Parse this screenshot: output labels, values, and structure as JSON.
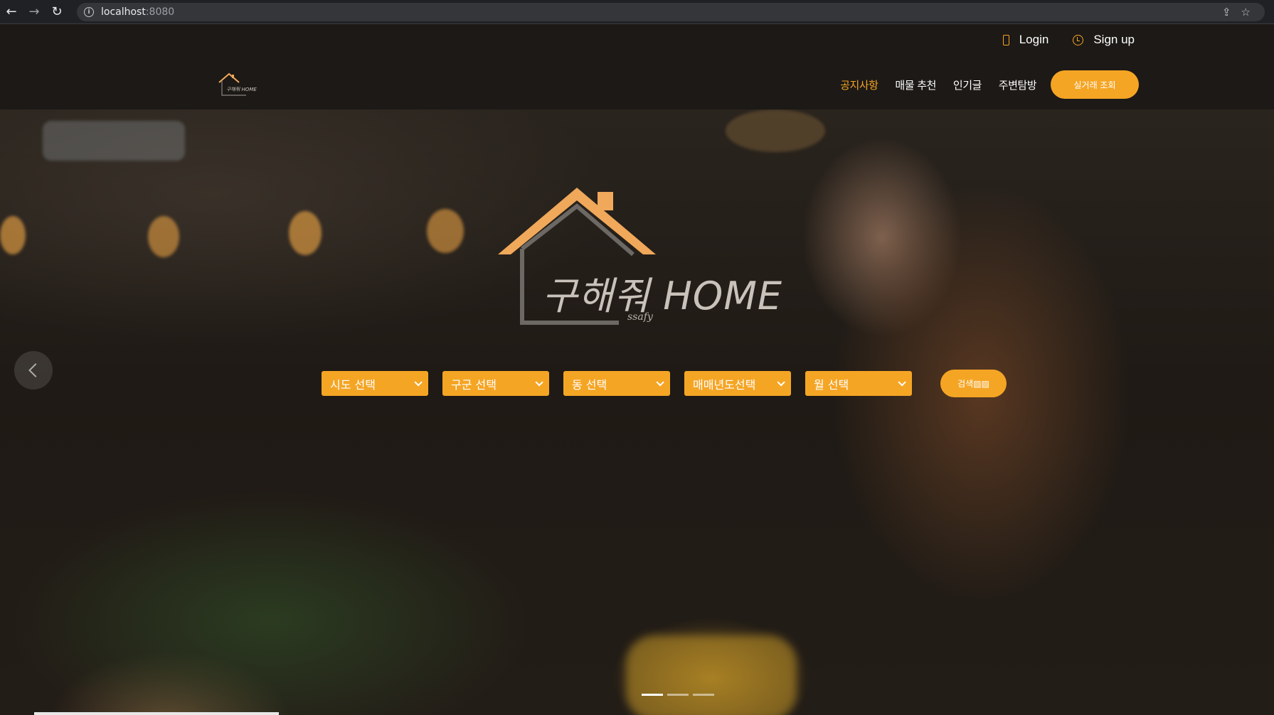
{
  "browser": {
    "back_icon": "←",
    "forward_icon": "→",
    "reload_icon": "↻",
    "url_host": "localhost",
    "url_port": ":8080",
    "share_icon": "⇪",
    "bookmark_icon": "☆"
  },
  "header": {
    "login_label": "Login",
    "signup_label": "Sign up",
    "small_logo_text": "구해줘 HOME",
    "nav": {
      "notice": "공지사항",
      "recommend": "매물 추천",
      "popular": "인기글",
      "explore": "주변탐방",
      "cta": "실거래 조회"
    }
  },
  "hero": {
    "logo_title": "구해줘 HOME",
    "logo_sub": "ssafy",
    "selects": {
      "sido": "시도 선택",
      "gugun": "구군 선택",
      "dong": "동 선택",
      "year": "매매년도선택",
      "month": "월 선택"
    },
    "search_label": "검색▨▨",
    "carousel_index": 0,
    "carousel_count": 3
  },
  "colors": {
    "accent": "#f5a524",
    "header_bg": "#1c1916"
  }
}
